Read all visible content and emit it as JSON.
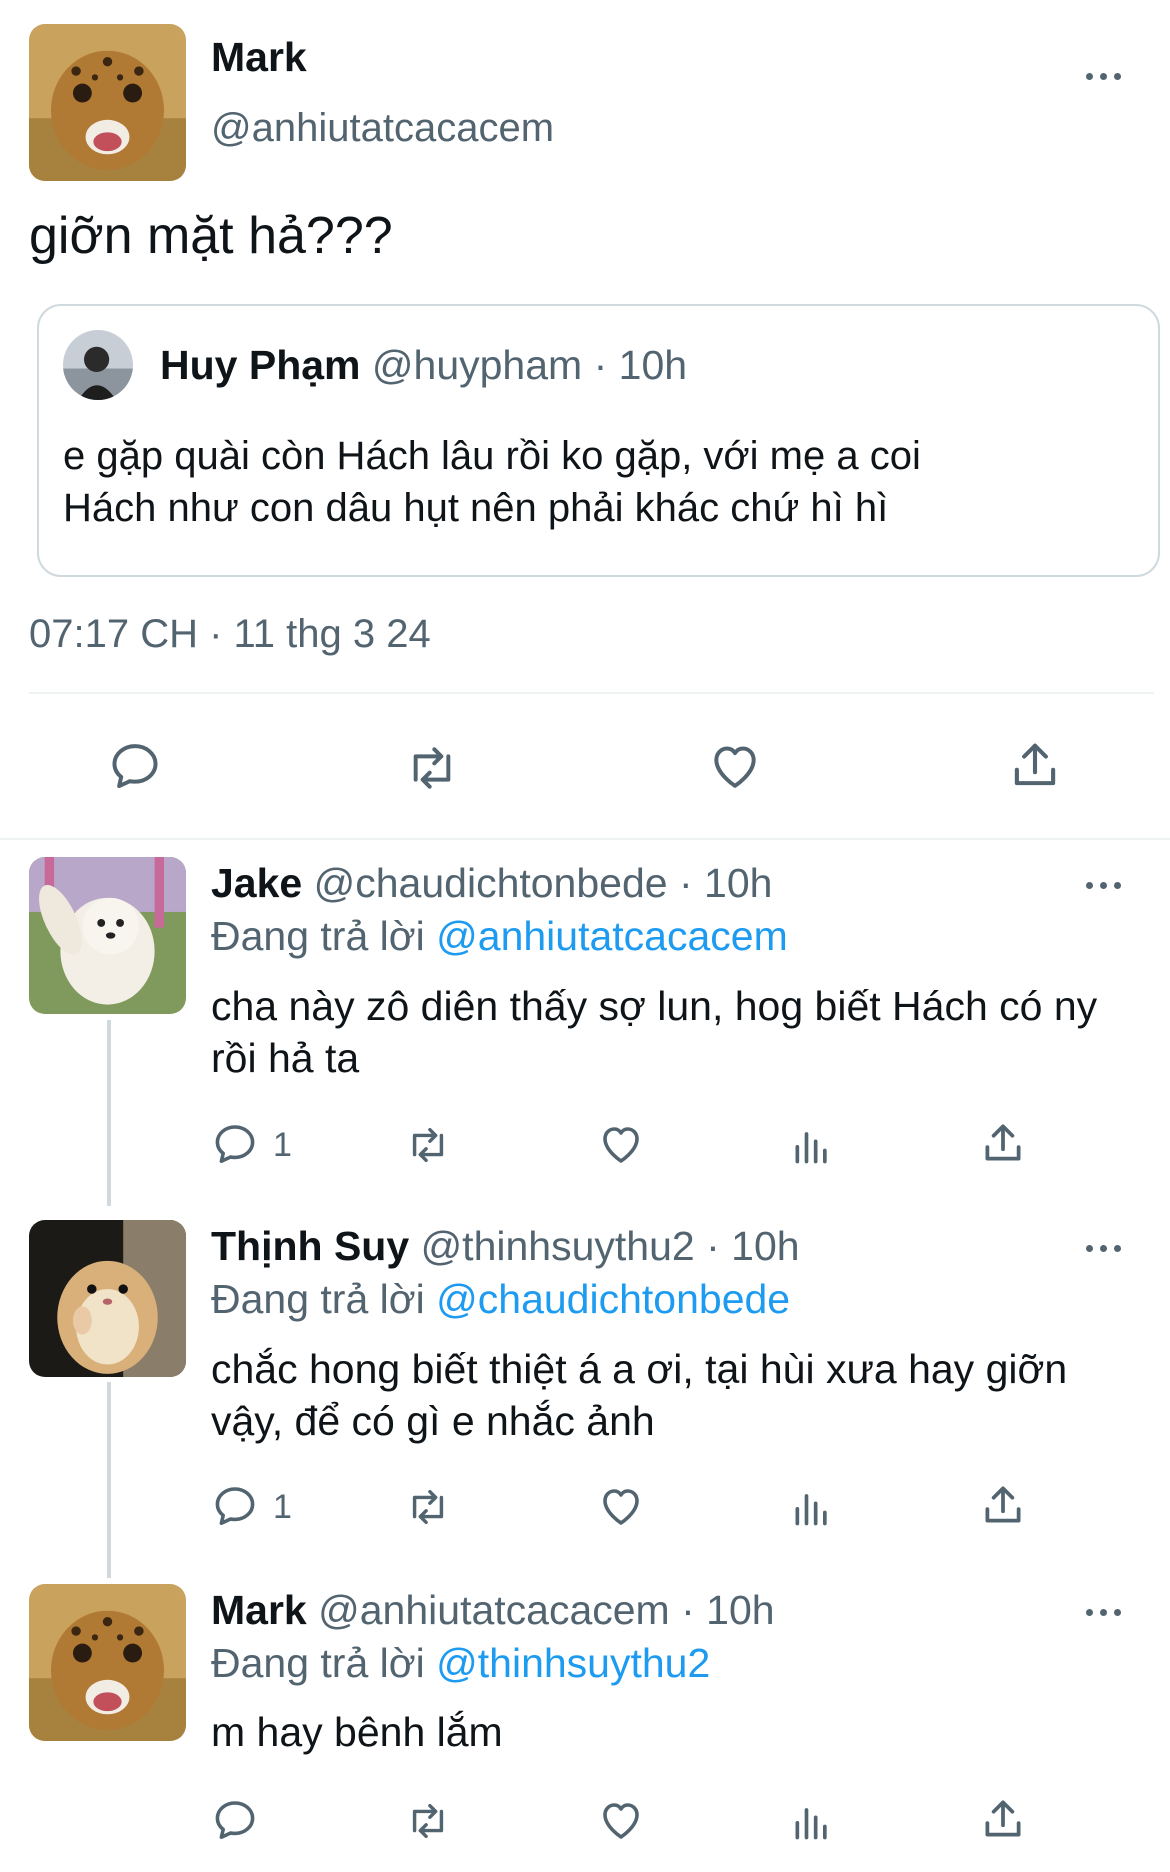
{
  "main_tweet": {
    "author_name": "Mark",
    "author_handle": "@anhiutatcacacem",
    "text": "giỡn mặt hả???",
    "timestamp": "07:17 CH · 11 thg 3 24",
    "quoted": {
      "author_name": "Huy Phạm",
      "author_handle": "@huypham",
      "time": "· 10h",
      "text_line1": "e gặp quài còn Hách lâu rồi ko gặp, với mẹ a coi",
      "text_line2": "Hách như con dâu hụt nên phải khác chứ hì hì"
    },
    "actions": [
      "reply-icon",
      "retweet-icon",
      "like-icon",
      "share-icon"
    ]
  },
  "replies": [
    {
      "author_name": "Jake",
      "author_handle": "@chaudichtonbede",
      "time": "· 10h",
      "replying_label": "Đang trả lời",
      "replying_to": "@anhiutatcacacem",
      "text": "cha này zô diên thấy sợ lun, hog biết Hách có ny rồi hả ta",
      "reply_count": "1"
    },
    {
      "author_name": "Thịnh Suy",
      "author_handle": "@thinhsuythu2",
      "time": "· 10h",
      "replying_label": "Đang trả lời",
      "replying_to": "@chaudichtonbede",
      "text": "chắc hong biết thiệt á a ơi, tại hùi xưa hay giỡn vậy, để có gì e nhắc ảnh",
      "reply_count": "1"
    },
    {
      "author_name": "Mark",
      "author_handle": "@anhiutatcacacem",
      "time": "· 10h",
      "replying_label": "Đang trả lời",
      "replying_to": "@thinhsuythu2",
      "text": "m hay bênh lắm",
      "reply_count": ""
    }
  ],
  "colors": {
    "text": "#0f1419",
    "secondary": "#536471",
    "link": "#1d9bf0",
    "border": "#cfd9de"
  }
}
